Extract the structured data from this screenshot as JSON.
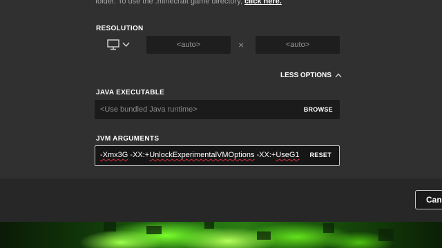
{
  "top_hint": {
    "text": "folder. To use the .minecraft game directory,",
    "link": "click here."
  },
  "resolution": {
    "label": "RESOLUTION",
    "monitor_icon": "monitor-icon",
    "dropdown_icon": "chevron-down-icon",
    "width_placeholder": "<auto>",
    "height_placeholder": "<auto>",
    "separator": "×"
  },
  "options_toggle": {
    "label": "LESS OPTIONS",
    "icon": "chevron-up-icon"
  },
  "java_executable": {
    "label": "JAVA EXECUTABLE",
    "placeholder": "<Use bundled Java runtime>",
    "button": "BROWSE"
  },
  "jvm_arguments": {
    "label": "JVM ARGUMENTS",
    "segments": [
      "-Xmx3G",
      " -XX:+",
      "UnlockExperimentalVMOptions",
      " -XX:+",
      "UseG1"
    ],
    "button": "RESET"
  },
  "footer": {
    "cancel_label": "Cancel"
  },
  "colors": {
    "panel": "#303030",
    "input": "#1b1b1b",
    "spellcheck_underline": "#d0303a",
    "accent_green": "#79ff2c"
  }
}
